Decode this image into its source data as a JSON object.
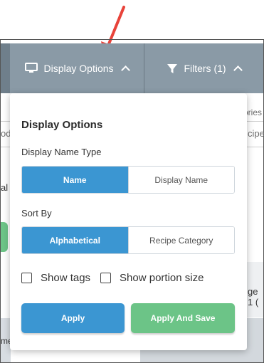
{
  "toolbar": {
    "display_options_label": "Display Options",
    "filters_label": "Filters (1)"
  },
  "background": {
    "text_ories": "ories",
    "text_od": "od",
    "text_cipe": "cipe",
    "text_al": "al",
    "text_ge1": "ge 1 (",
    "text_me": "me"
  },
  "popup": {
    "title": "Display Options",
    "display_name_type": {
      "label": "Display Name Type",
      "options": [
        "Name",
        "Display Name"
      ],
      "selected": "Name"
    },
    "sort_by": {
      "label": "Sort By",
      "options": [
        "Alphabetical",
        "Recipe Category"
      ],
      "selected": "Alphabetical"
    },
    "checkboxes": [
      {
        "label": "Show tags",
        "checked": false
      },
      {
        "label": "Show portion size",
        "checked": false
      }
    ],
    "apply_label": "Apply",
    "apply_save_label": "Apply And Save"
  },
  "colors": {
    "toolbar": "#8a9aa6",
    "primary": "#3b96d2",
    "success": "#6cc487",
    "arrow": "#e8433a"
  }
}
